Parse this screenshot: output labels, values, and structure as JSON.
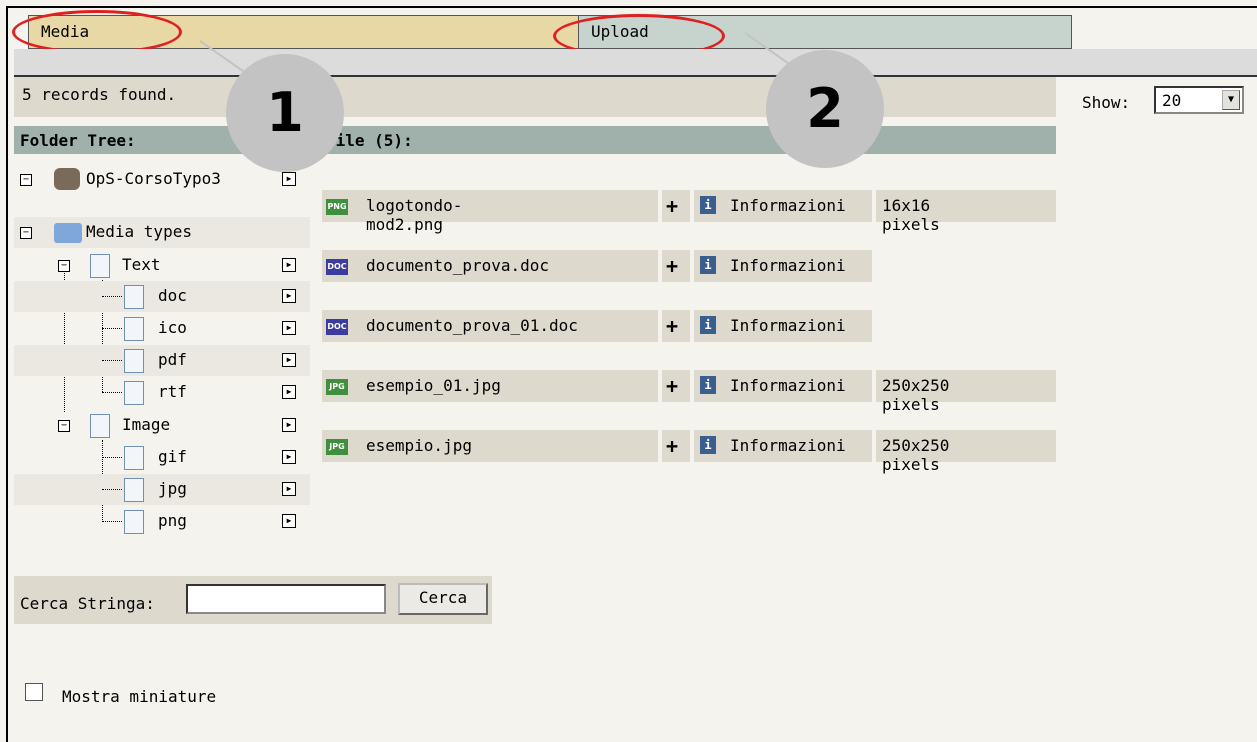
{
  "tabs": {
    "media": "Media",
    "upload": "Upload"
  },
  "records_found": "5 records found.",
  "show": {
    "label": "Show:",
    "value": "20"
  },
  "headers": {
    "folder_tree": "Folder Tree:",
    "file": "File (5):"
  },
  "tree": {
    "root": "OpS-CorsoTypo3",
    "media_types": "Media types",
    "text": "Text",
    "text_children": [
      "doc",
      "ico",
      "pdf",
      "rtf"
    ],
    "image": "Image",
    "image_children": [
      "gif",
      "jpg",
      "png"
    ]
  },
  "files": [
    {
      "type": "PNG",
      "name": "logotondo-mod2.png",
      "info": "Informazioni",
      "dims": "16x16 pixels",
      "color": "#3f8f3f"
    },
    {
      "type": "DOC",
      "name": "documento_prova.doc",
      "info": "Informazioni",
      "dims": "",
      "color": "#3b3ba0"
    },
    {
      "type": "DOC",
      "name": "documento_prova_01.doc",
      "info": "Informazioni",
      "dims": "",
      "color": "#3b3ba0"
    },
    {
      "type": "JPG",
      "name": "esempio_01.jpg",
      "info": "Informazioni",
      "dims": "250x250 pixels",
      "color": "#3f8f3f"
    },
    {
      "type": "JPG",
      "name": "esempio.jpg",
      "info": "Informazioni",
      "dims": "250x250 pixels",
      "color": "#3f8f3f"
    }
  ],
  "search": {
    "label": "Cerca Stringa:",
    "value": "",
    "button": "Cerca"
  },
  "thumbnails": {
    "label": "Mostra miniature",
    "checked": false
  },
  "callouts": [
    "1",
    "2"
  ]
}
